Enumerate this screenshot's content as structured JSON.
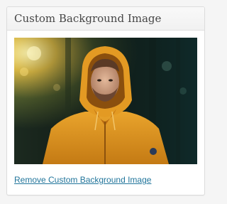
{
  "widget": {
    "title": "Custom Background Image",
    "image_icon": "photo-icon",
    "remove_link_label": "Remove Custom Background Image"
  },
  "colors": {
    "link": "#21759b",
    "title": "#464646",
    "panel_border": "#dcdcdc",
    "page_bg": "#f5f5f5"
  }
}
